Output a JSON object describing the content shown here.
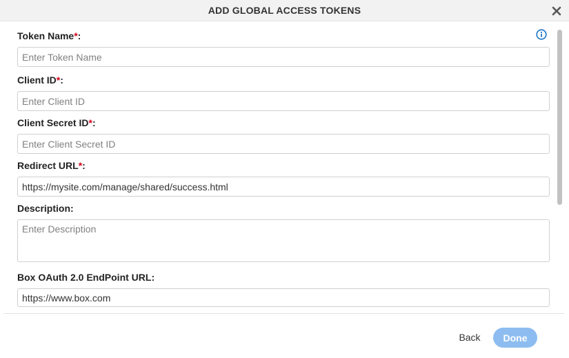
{
  "dialog": {
    "title": "ADD GLOBAL ACCESS TOKENS"
  },
  "form": {
    "token_name": {
      "label": "Token Name",
      "required_mark": "*",
      "suffix": ":",
      "placeholder": "Enter Token Name",
      "value": ""
    },
    "client_id": {
      "label": "Client ID",
      "required_mark": "*",
      "suffix": ":",
      "placeholder": "Enter Client ID",
      "value": ""
    },
    "client_secret_id": {
      "label": "Client Secret ID",
      "required_mark": "*",
      "suffix": ":",
      "placeholder": "Enter Client Secret ID",
      "value": ""
    },
    "redirect_url": {
      "label": "Redirect URL",
      "required_mark": "*",
      "suffix": ":",
      "placeholder": "",
      "value": "https://mysite.com/manage/shared/success.html"
    },
    "description": {
      "label": "Description:",
      "placeholder": "Enter Description",
      "value": ""
    },
    "box_oauth_endpoint_url": {
      "label": "Box OAuth 2.0 EndPoint URL:",
      "placeholder": "",
      "value": "https://www.box.com"
    }
  },
  "footer": {
    "back_label": "Back",
    "done_label": "Done"
  },
  "icons": {
    "close": "close-icon",
    "info": "info-icon"
  },
  "colors": {
    "required": "#d0021b",
    "info_icon": "#1a73c9",
    "done_button": "#8dbdf0",
    "header_bg": "#f2f2f2"
  }
}
